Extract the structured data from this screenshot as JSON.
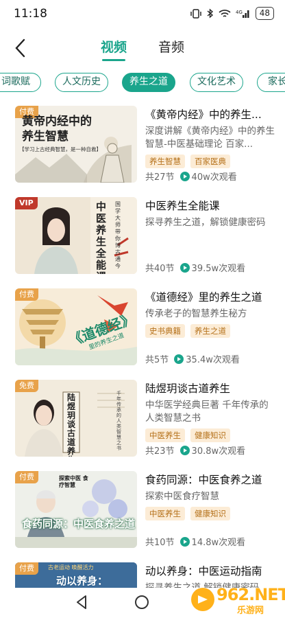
{
  "status_bar": {
    "time": "11:18",
    "battery": "48",
    "signal_label": "4G"
  },
  "header": {
    "tabs": [
      {
        "label": "视频",
        "active": true
      },
      {
        "label": "音频",
        "active": false
      }
    ]
  },
  "categories": [
    {
      "label": "词歌赋",
      "active": false
    },
    {
      "label": "人文历史",
      "active": false
    },
    {
      "label": "养生之道",
      "active": true
    },
    {
      "label": "文化艺术",
      "active": false
    },
    {
      "label": "家长",
      "active": false
    }
  ],
  "courses": [
    {
      "badge": "付费",
      "thumb_text": "黄帝内经中的养生智慧",
      "thumb_sub": "【学习上古经典智慧，是一种自救】",
      "title": "《黄帝内经》中的养生...",
      "desc": "深度讲解《黄帝内经》中的养生智慧-中医基础理论  百家...",
      "tags": [
        "养生智慧",
        "百家医典"
      ],
      "lessons": "共27节",
      "views": "40w次观看"
    },
    {
      "badge": "VIP",
      "thumb_text": "中医养生全能课",
      "thumb_sub": "国学大师带你博古通今",
      "title": "中医养生全能课",
      "desc": "探寻养生之道，解锁健康密码",
      "tags": [],
      "lessons": "共40节",
      "views": "39.5w次观看"
    },
    {
      "badge": "付费",
      "thumb_text": "《道德经》",
      "thumb_sub": "里的养生之道",
      "title": "《道德经》里的养生之道",
      "desc": "传承老子的智慧养生秘方",
      "tags": [
        "史书典籍",
        "养生之道"
      ],
      "lessons": "共5节",
      "views": "35.4w次观看"
    },
    {
      "badge": "免费",
      "thumb_text": "陆煜玥谈古道养生",
      "thumb_sub": "千年传承的人类智慧之书",
      "title": "陆煜玥谈古道养生",
      "desc": "中华医学经典巨著 千年传承的人类智慧之书",
      "tags": [
        "中医养生",
        "健康知识"
      ],
      "lessons": "共23节",
      "views": "30.8w次观看"
    },
    {
      "badge": "付费",
      "thumb_text": "食药同源：中医食养之道",
      "thumb_sub": "探索中医 食疗智慧",
      "title": "食药同源：中医食养之道",
      "desc": "探索中医食疗智慧",
      "tags": [
        "中医养生",
        "健康知识"
      ],
      "lessons": "共10节",
      "views": "14.8w次观看"
    },
    {
      "badge": "付费",
      "thumb_text": "动以养身：",
      "thumb_sub": "古老运动 唤醒活力",
      "title": "动以养身：中医运动指南",
      "desc": "探寻养生之道 解锁健康密码",
      "tags": [],
      "lessons": "",
      "views": ""
    }
  ],
  "watermark": {
    "text": "962.NET",
    "sub": "乐游网"
  },
  "colors": {
    "accent": "#1aa58c",
    "tag_text": "#b5711a",
    "tag_bg": "#fcecd6",
    "badge": "#e8a24a"
  }
}
